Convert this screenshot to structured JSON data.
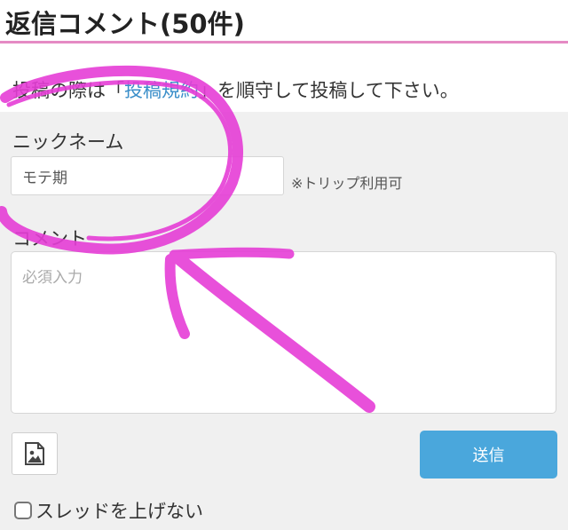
{
  "header": {
    "title": "返信コメント(50件)"
  },
  "notice": {
    "before": "投稿の際は「",
    "link": "投稿規約",
    "after": "」を順守して投稿して下さい。"
  },
  "form": {
    "nickname_label": "ニックネーム",
    "nickname_value": "モテ期",
    "trip_note": "※トリップ利用可",
    "comment_label": "コメント",
    "comment_placeholder": "必須入力",
    "image_icon": "image-icon",
    "send_label": "送信",
    "no_bump_label": "スレッドを上げない"
  },
  "colors": {
    "accent_pink": "#e58ac4",
    "link_blue": "#3a8ec9",
    "send_button": "#4aa7dc",
    "marker_magenta": "#e63ed6"
  }
}
